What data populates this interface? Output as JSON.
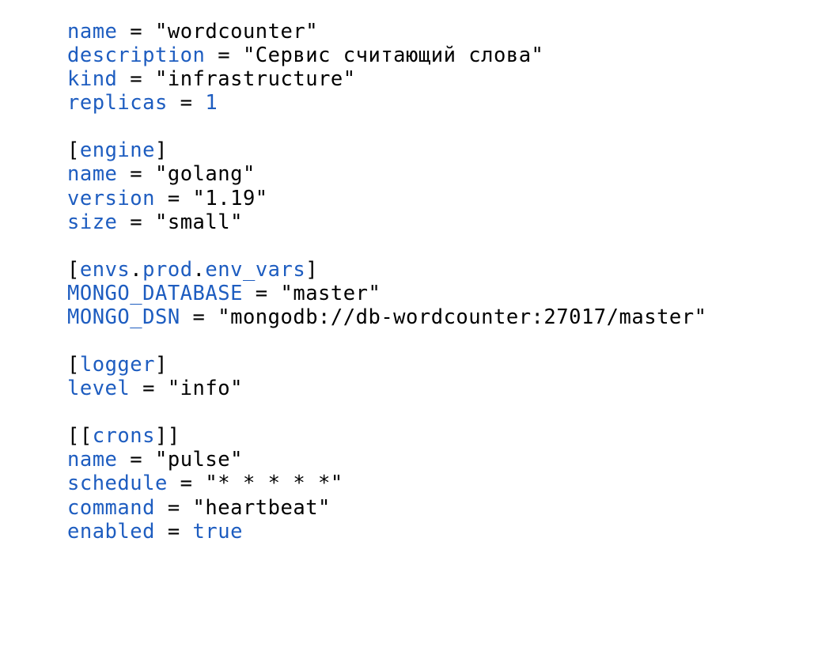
{
  "toml": {
    "root": {
      "name": {
        "key": "name",
        "value": "\"wordcounter\""
      },
      "description": {
        "key": "description",
        "value": "\"Сервис считающий слова\""
      },
      "kind": {
        "key": "kind",
        "value": "\"infrastructure\""
      },
      "replicas": {
        "key": "replicas",
        "value": "1"
      }
    },
    "engine": {
      "header": "engine",
      "name": {
        "key": "name",
        "value": "\"golang\""
      },
      "version": {
        "key": "version",
        "value": "\"1.19\""
      },
      "size": {
        "key": "size",
        "value": "\"small\""
      }
    },
    "envs": {
      "header_parts": [
        "envs",
        "prod",
        "env_vars"
      ],
      "mongo_database": {
        "key": "MONGO_DATABASE",
        "value": "\"master\""
      },
      "mongo_dsn": {
        "key": "MONGO_DSN",
        "value": "\"mongodb://db-wordcounter:27017/master\""
      }
    },
    "logger": {
      "header": "logger",
      "level": {
        "key": "level",
        "value": "\"info\""
      }
    },
    "crons": {
      "header": "crons",
      "name": {
        "key": "name",
        "value": "\"pulse\""
      },
      "schedule": {
        "key": "schedule",
        "value": "\"* * * * *\""
      },
      "command": {
        "key": "command",
        "value": "\"heartbeat\""
      },
      "enabled": {
        "key": "enabled",
        "value": "true"
      }
    }
  }
}
